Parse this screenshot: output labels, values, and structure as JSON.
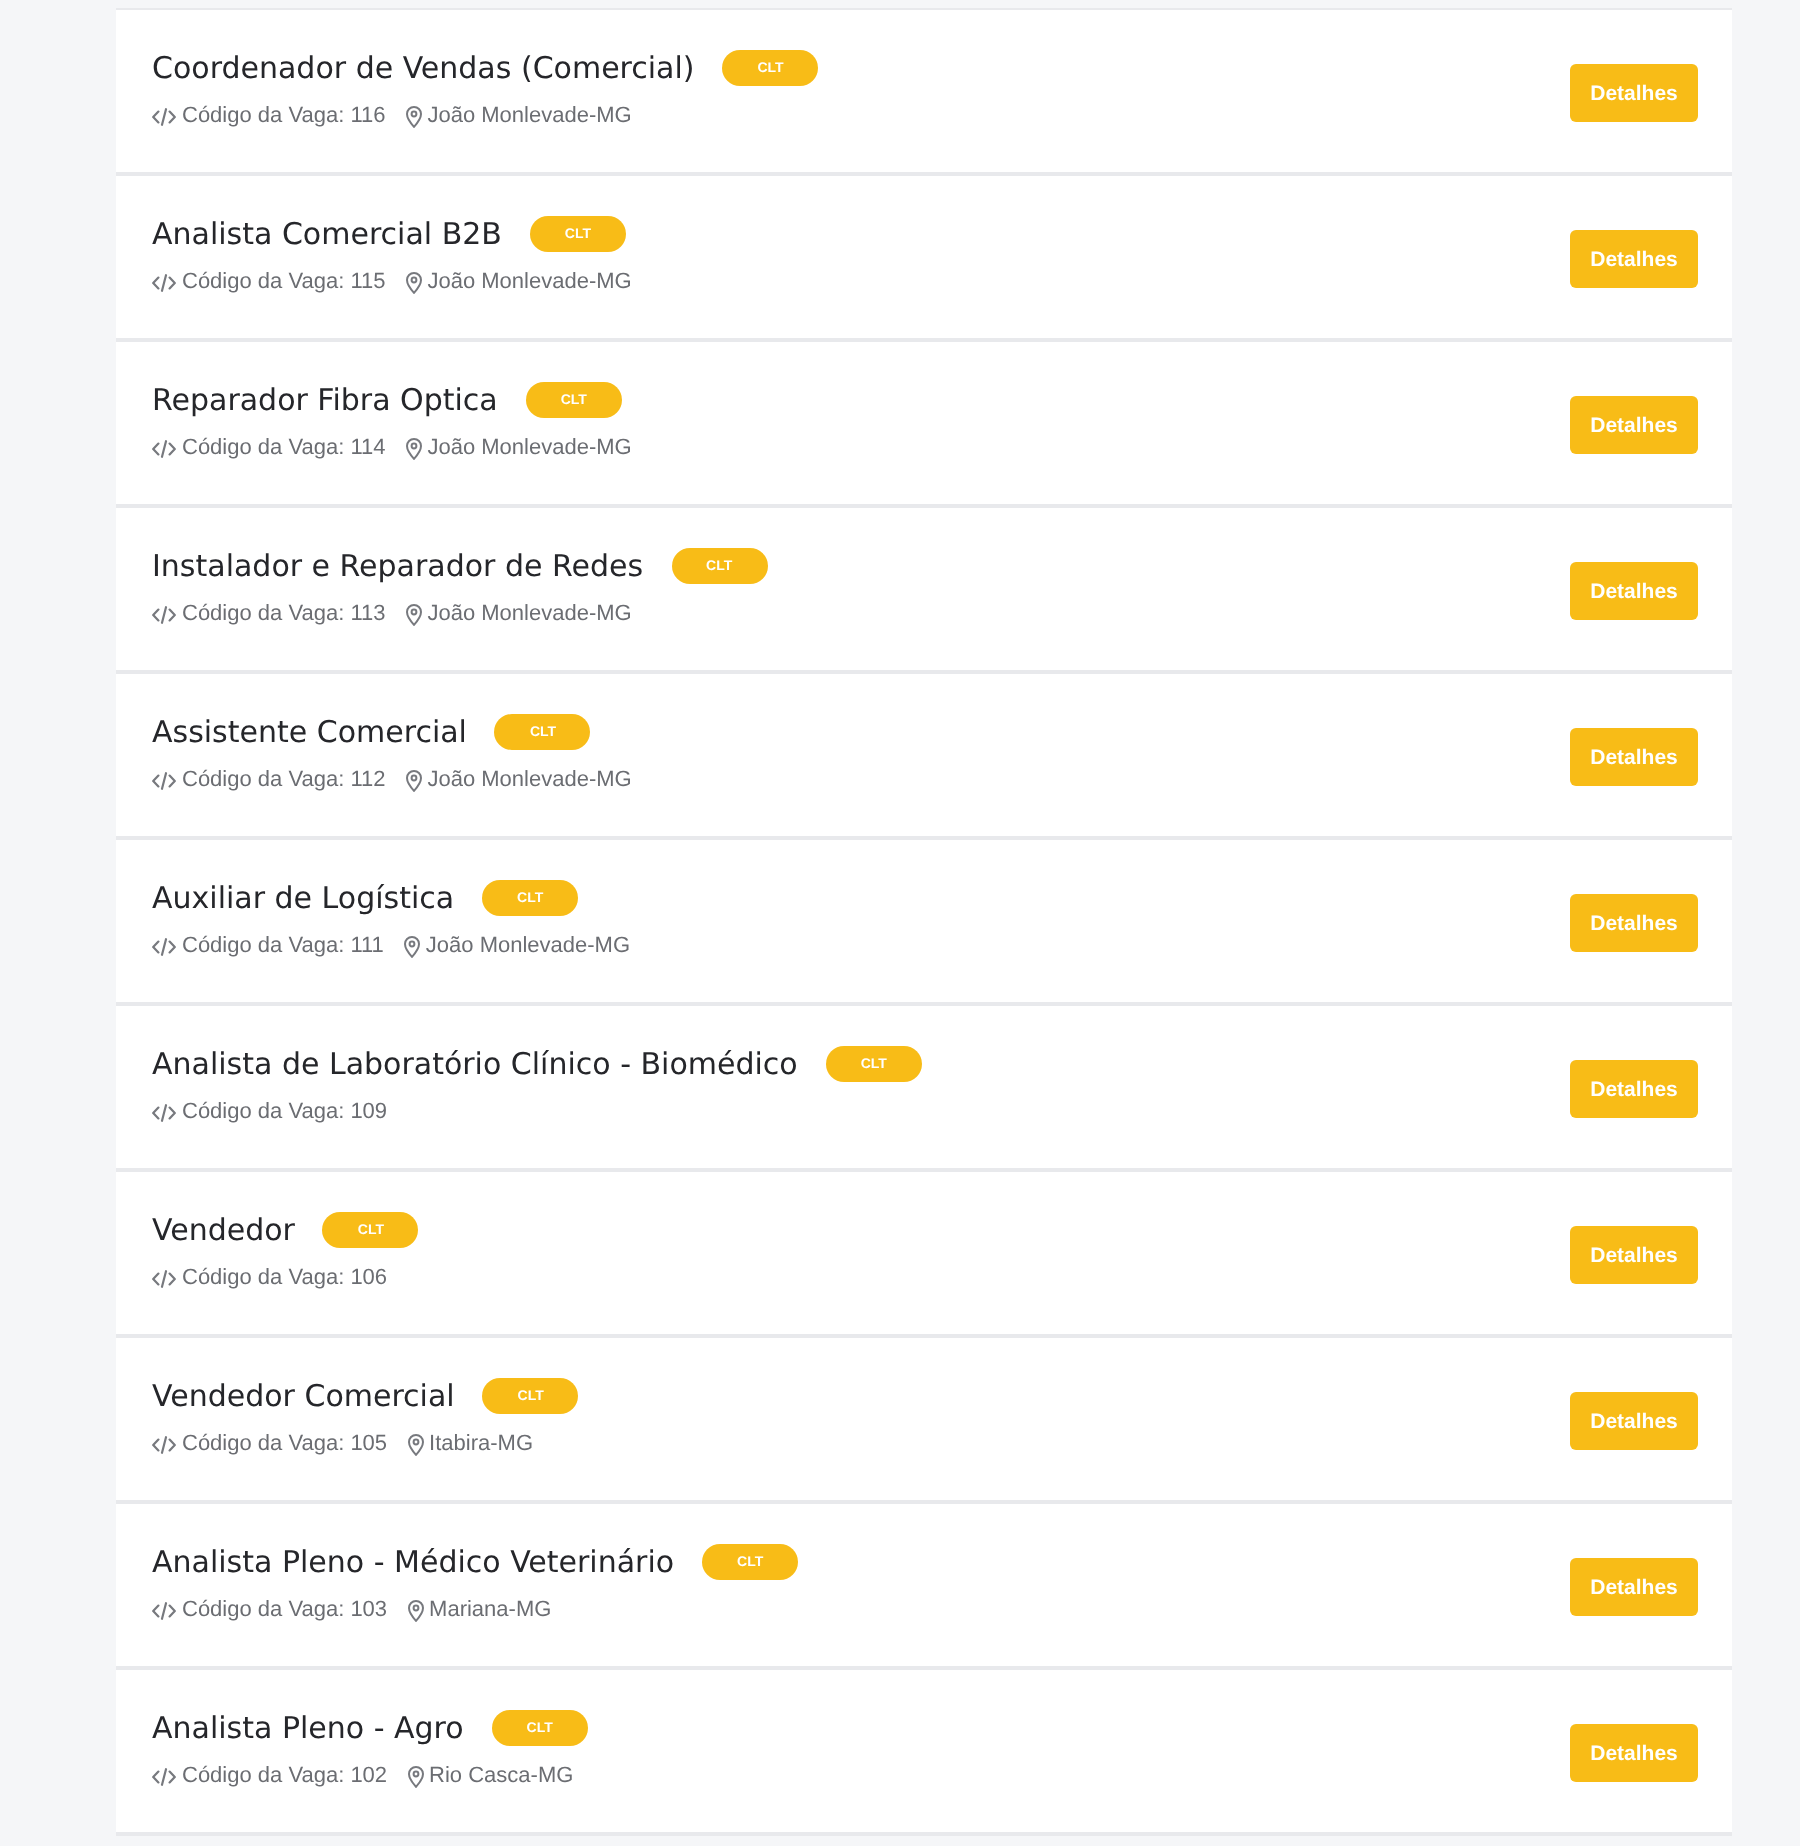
{
  "jobs": [
    {
      "title": "Coordenador de Vendas (Comercial)",
      "contract": "CLT",
      "code": "Código da Vaga: 116",
      "location": "João Monlevade-MG",
      "action": "Detalhes"
    },
    {
      "title": "Analista Comercial B2B",
      "contract": "CLT",
      "code": "Código da Vaga: 115",
      "location": "João Monlevade-MG",
      "action": "Detalhes"
    },
    {
      "title": "Reparador Fibra Optica",
      "contract": "CLT",
      "code": "Código da Vaga: 114",
      "location": "João Monlevade-MG",
      "action": "Detalhes"
    },
    {
      "title": "Instalador e Reparador de Redes",
      "contract": "CLT",
      "code": "Código da Vaga: 113",
      "location": "João Monlevade-MG",
      "action": "Detalhes"
    },
    {
      "title": "Assistente Comercial",
      "contract": "CLT",
      "code": "Código da Vaga: 112",
      "location": "João Monlevade-MG",
      "action": "Detalhes"
    },
    {
      "title": "Auxiliar de Logística",
      "contract": "CLT",
      "code": "Código da Vaga: 111",
      "location": "João Monlevade-MG",
      "action": "Detalhes"
    },
    {
      "title": "Analista de Laboratório Clínico - Biomédico",
      "contract": "CLT",
      "code": "Código da Vaga: 109",
      "action": "Detalhes"
    },
    {
      "title": "Vendedor",
      "contract": "CLT",
      "code": "Código da Vaga: 106",
      "action": "Detalhes"
    },
    {
      "title": "Vendedor Comercial",
      "contract": "CLT",
      "code": "Código da Vaga: 105",
      "location": "Itabira-MG",
      "action": "Detalhes"
    },
    {
      "title": "Analista Pleno - Médico Veterinário",
      "contract": "CLT",
      "code": "Código da Vaga: 103",
      "location": "Mariana-MG",
      "action": "Detalhes"
    },
    {
      "title": "Analista Pleno - Agro",
      "contract": "CLT",
      "code": "Código da Vaga: 102",
      "location": "Rio Casca-MG",
      "action": "Detalhes"
    }
  ]
}
